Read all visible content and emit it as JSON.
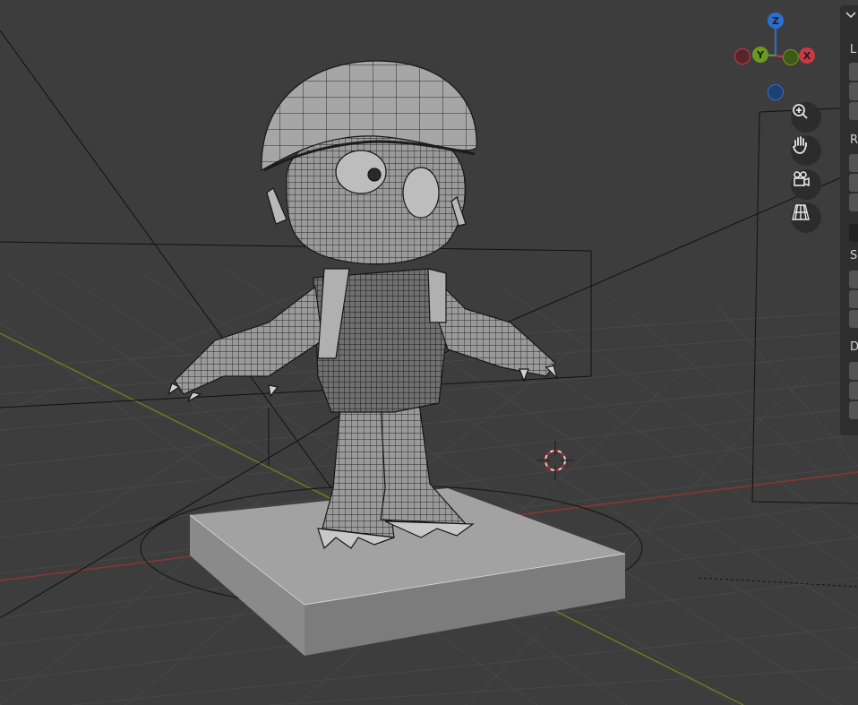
{
  "gizmo": {
    "axes": [
      {
        "label": "Z",
        "color": "#2c6fd1"
      },
      {
        "label": "Y",
        "color": "#6a9a1f"
      },
      {
        "label": "X",
        "color": "#c83a44"
      },
      {
        "label": "",
        "color": "#2c6fd1"
      },
      {
        "label": "",
        "color": "#8a2d34"
      },
      {
        "label": "",
        "color": "#5d8a1b"
      }
    ]
  },
  "nav_buttons": [
    {
      "icon": "zoom-icon"
    },
    {
      "icon": "hand-pan-icon"
    },
    {
      "icon": "camera-icon"
    },
    {
      "icon": "ortho-grid-icon"
    }
  ],
  "side_panel": {
    "section_labels": [
      "L",
      "R",
      "S",
      "D"
    ]
  },
  "colors": {
    "viewport_bg": "#3d3d3d",
    "grid_line": "#474747",
    "x_axis": "#a33a3a",
    "y_axis": "#6b8a2a",
    "mesh_fill": "#8c8c8c",
    "wire": "#1e1e1e"
  }
}
